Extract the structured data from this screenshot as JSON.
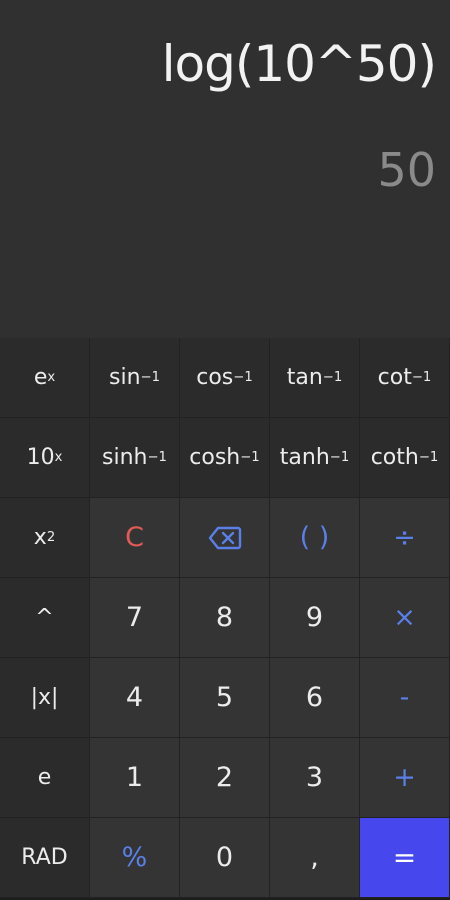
{
  "display": {
    "expression": "log(10^50)",
    "result": "50"
  },
  "keypad": {
    "row1": [
      {
        "base": "e",
        "sup": "x"
      },
      {
        "base": "sin",
        "sup": "−1"
      },
      {
        "base": "cos",
        "sup": "−1"
      },
      {
        "base": "tan",
        "sup": "−1"
      },
      {
        "base": "cot",
        "sup": "−1"
      }
    ],
    "row2": [
      {
        "base": "10",
        "sup": "x"
      },
      {
        "base": "sinh",
        "sup": "−1"
      },
      {
        "base": "cosh",
        "sup": "−1"
      },
      {
        "base": "tanh",
        "sup": "−1"
      },
      {
        "base": "coth",
        "sup": "−1"
      }
    ],
    "row3": [
      {
        "base": "x",
        "sup": "2"
      },
      {
        "label": "C"
      },
      {
        "icon": "backspace-icon"
      },
      {
        "label": "( )"
      },
      {
        "label": "÷"
      }
    ],
    "row4": [
      {
        "label": "^"
      },
      {
        "label": "7"
      },
      {
        "label": "8"
      },
      {
        "label": "9"
      },
      {
        "label": "×"
      }
    ],
    "row5": [
      {
        "label": "|x|"
      },
      {
        "label": "4"
      },
      {
        "label": "5"
      },
      {
        "label": "6"
      },
      {
        "label": "-"
      }
    ],
    "row6": [
      {
        "label": "e"
      },
      {
        "label": "1"
      },
      {
        "label": "2"
      },
      {
        "label": "3"
      },
      {
        "label": "+"
      }
    ],
    "row7": [
      {
        "label": "RAD"
      },
      {
        "label": "%"
      },
      {
        "label": "0"
      },
      {
        "label": ","
      },
      {
        "label": "="
      }
    ]
  },
  "colors": {
    "display_bg": "#303030",
    "expression_text": "#f2f2f2",
    "result_text": "#8a8a8a",
    "operator_blue": "#5b7fe8",
    "clear_red": "#e05a57",
    "equals_bg": "#4747ee"
  }
}
